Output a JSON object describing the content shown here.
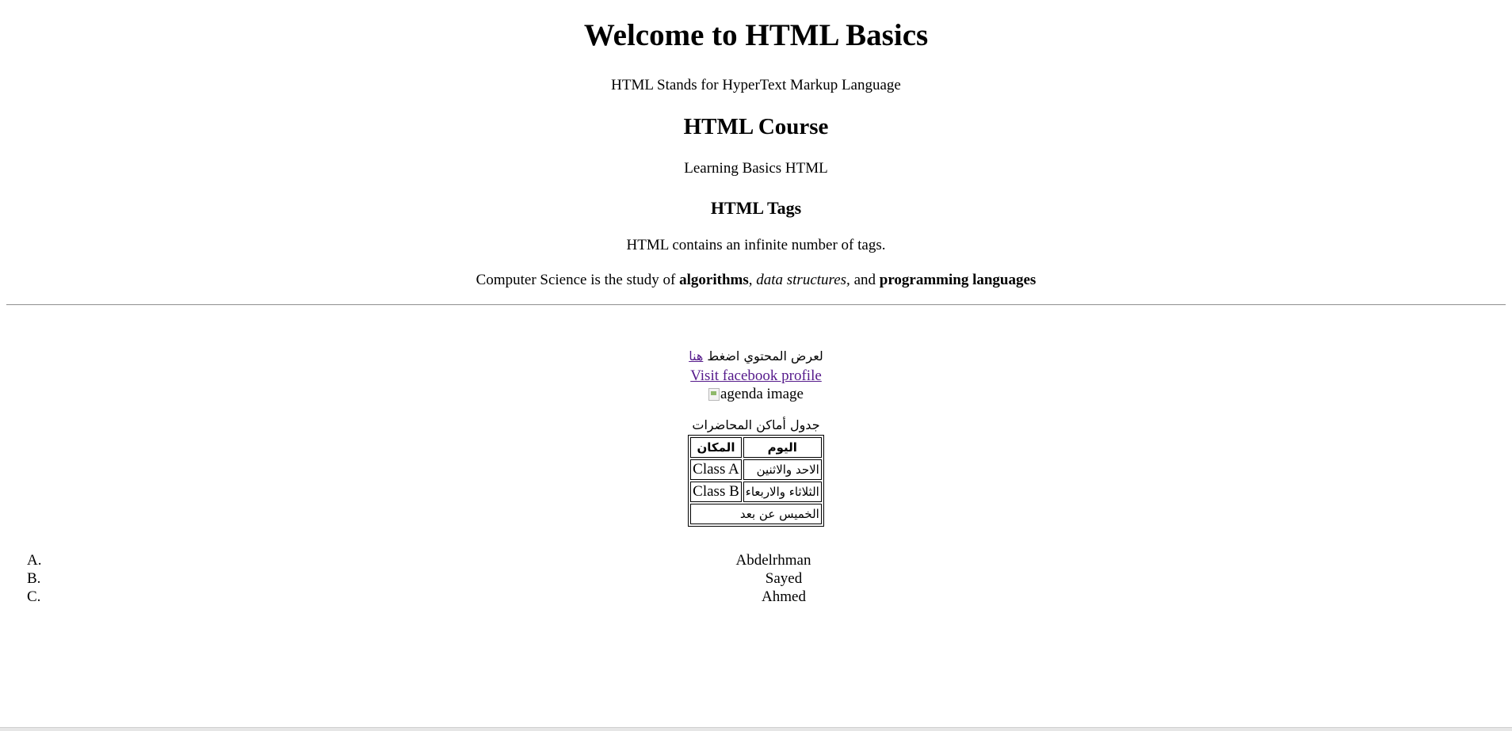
{
  "heading_main": "Welcome to HTML Basics",
  "para_html_stands": "HTML Stands for HyperText Markup Language",
  "heading_course": "HTML Course",
  "para_learning": "Learning Basics HTML",
  "heading_tags": "HTML Tags",
  "para_tags": "HTML contains an infinite number of tags.",
  "cs_sentence": {
    "prefix": "Computer Science is the study of ",
    "algorithms": "algorithms",
    "comma": ", ",
    "data_structures": "data structures,",
    "and": " and ",
    "programming_languages": "programming languages"
  },
  "arabic_link_line": {
    "text": "لعرض المحتوي اضغط ",
    "link": "هنا"
  },
  "facebook_link": "Visit facebook profile",
  "image_alt": "agenda image",
  "table": {
    "caption": "جدول أماكن المحاضرات",
    "headers": [
      "اليوم",
      "المكان"
    ],
    "rows": [
      {
        "day": "الاحد والاثنين",
        "place": "Class A"
      },
      {
        "day": "الثلاثاء والاربعاء",
        "place": "Class B"
      }
    ],
    "last_row": "الخميس عن بعد"
  },
  "list": [
    {
      "marker": "A.",
      "text": "Abdelrhman"
    },
    {
      "marker": "B.",
      "text": "Sayed"
    },
    {
      "marker": "C.",
      "text": "Ahmed"
    }
  ]
}
